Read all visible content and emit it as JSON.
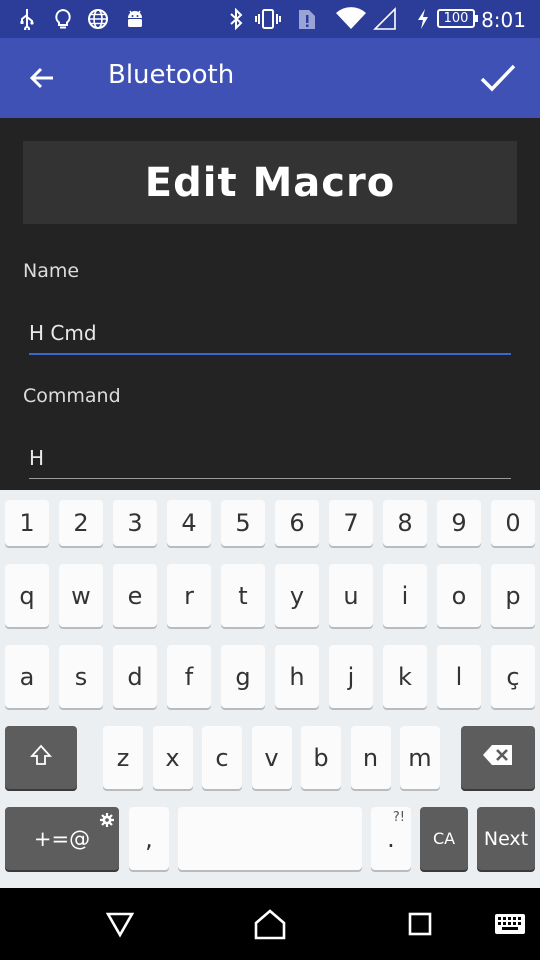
{
  "status_bar": {
    "time": "8:01",
    "battery": "100",
    "icons": [
      "usb-icon",
      "lightbulb-icon",
      "globe-icon",
      "android-icon",
      "bluetooth-icon",
      "vibrate-icon",
      "alert-icon",
      "wifi-icon",
      "signal-icon",
      "charging-icon"
    ]
  },
  "toolbar": {
    "title": "Bluetooth",
    "back_icon": "arrow-back-icon",
    "confirm_icon": "check-icon"
  },
  "content": {
    "header": "Edit Macro",
    "name_label": "Name",
    "name_value": "H Cmd",
    "command_label": "Command",
    "command_value": "H"
  },
  "keyboard": {
    "row1": [
      "1",
      "2",
      "3",
      "4",
      "5",
      "6",
      "7",
      "8",
      "9",
      "0"
    ],
    "row2": [
      "q",
      "w",
      "e",
      "r",
      "t",
      "y",
      "u",
      "i",
      "o",
      "p"
    ],
    "row3": [
      "a",
      "s",
      "d",
      "f",
      "g",
      "h",
      "j",
      "k",
      "l",
      "ç"
    ],
    "row4": [
      "z",
      "x",
      "c",
      "v",
      "b",
      "n",
      "m"
    ],
    "symbols_label": "+=@",
    "comma_label": ",",
    "period_label": ".",
    "period_hint": "?!",
    "lang_label": "CA",
    "next_label": "Next"
  },
  "colors": {
    "status_bar": "#2c3d99",
    "toolbar": "#3f51b5",
    "background": "#232323",
    "accent_underline": "#3f66d0"
  }
}
